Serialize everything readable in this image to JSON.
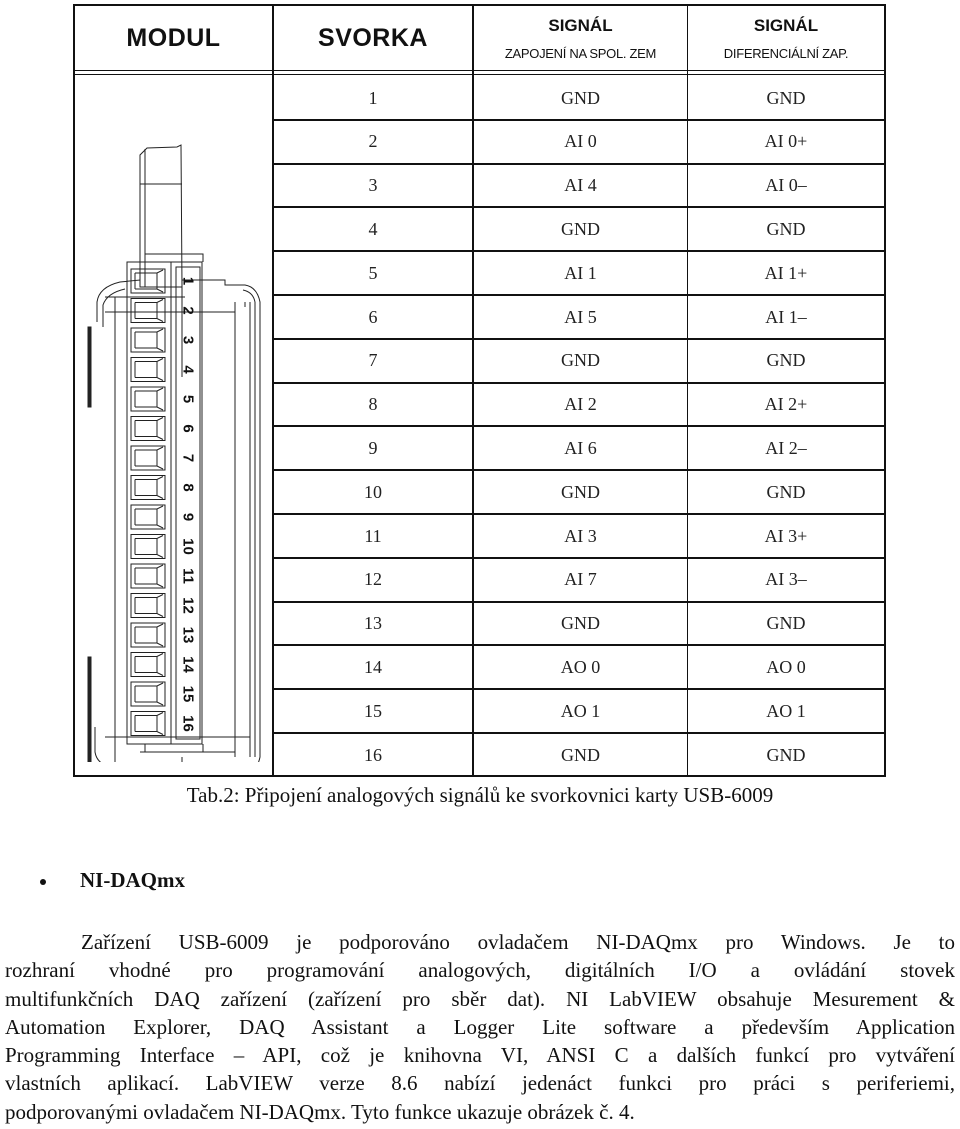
{
  "table": {
    "headers": {
      "modul": "MODUL",
      "svorka": "SVORKA",
      "signal_se_title": "SIGNÁL",
      "signal_se_sub": "ZAPOJENÍ NA SPOL. ZEM",
      "signal_diff_title": "SIGNÁL",
      "signal_diff_sub": "DIFERENCIÁLNÍ ZAP."
    },
    "rows": [
      {
        "terminal": "1",
        "single_ended": "GND",
        "differential": "GND"
      },
      {
        "terminal": "2",
        "single_ended": "AI 0",
        "differential": "AI 0+"
      },
      {
        "terminal": "3",
        "single_ended": "AI 4",
        "differential": "AI 0–"
      },
      {
        "terminal": "4",
        "single_ended": "GND",
        "differential": "GND"
      },
      {
        "terminal": "5",
        "single_ended": "AI 1",
        "differential": "AI 1+"
      },
      {
        "terminal": "6",
        "single_ended": "AI 5",
        "differential": "AI 1–"
      },
      {
        "terminal": "7",
        "single_ended": "GND",
        "differential": "GND"
      },
      {
        "terminal": "8",
        "single_ended": "AI 2",
        "differential": "AI 2+"
      },
      {
        "terminal": "9",
        "single_ended": "AI 6",
        "differential": "AI 2–"
      },
      {
        "terminal": "10",
        "single_ended": "GND",
        "differential": "GND"
      },
      {
        "terminal": "11",
        "single_ended": "AI 3",
        "differential": "AI 3+"
      },
      {
        "terminal": "12",
        "single_ended": "AI 7",
        "differential": "AI 3–"
      },
      {
        "terminal": "13",
        "single_ended": "GND",
        "differential": "GND"
      },
      {
        "terminal": "14",
        "single_ended": "AO 0",
        "differential": "AO 0"
      },
      {
        "terminal": "15",
        "single_ended": "AO 1",
        "differential": "AO 1"
      },
      {
        "terminal": "16",
        "single_ended": "GND",
        "differential": "GND"
      }
    ],
    "device_pin_labels": [
      "1",
      "2",
      "3",
      "4",
      "5",
      "6",
      "7",
      "8",
      "9",
      "10",
      "11",
      "12",
      "13",
      "14",
      "15",
      "16"
    ]
  },
  "caption": "Tab.2: Připojení analogových signálů ke svorkovnici karty USB-6009",
  "section": {
    "bullet_icon": "bullet-dot-icon",
    "heading": "NI-DAQmx",
    "paragraph_lines": [
      "Zařízení USB-6009 je podporováno ovladačem NI-DAQmx pro Windows. Je to",
      "rozhraní vhodné pro programování analogových, digitálních I/O a ovládání stovek",
      "multifunkčních DAQ zařízení (zařízení pro sběr dat). NI LabVIEW obsahuje Mesurement &",
      "Automation Explorer, DAQ Assistant a Logger Lite software a především Application",
      "Programming Interface – API, což je knihovna VI, ANSI C a dalších funkcí pro vytváření",
      "vlastních aplikací. LabVIEW verze 8.6 nabízí jedenáct funkci pro práci s periferiemi,",
      "podporovanými ovladačem NI-DAQmx. Tyto funkce ukazuje obrázek č. 4."
    ]
  }
}
